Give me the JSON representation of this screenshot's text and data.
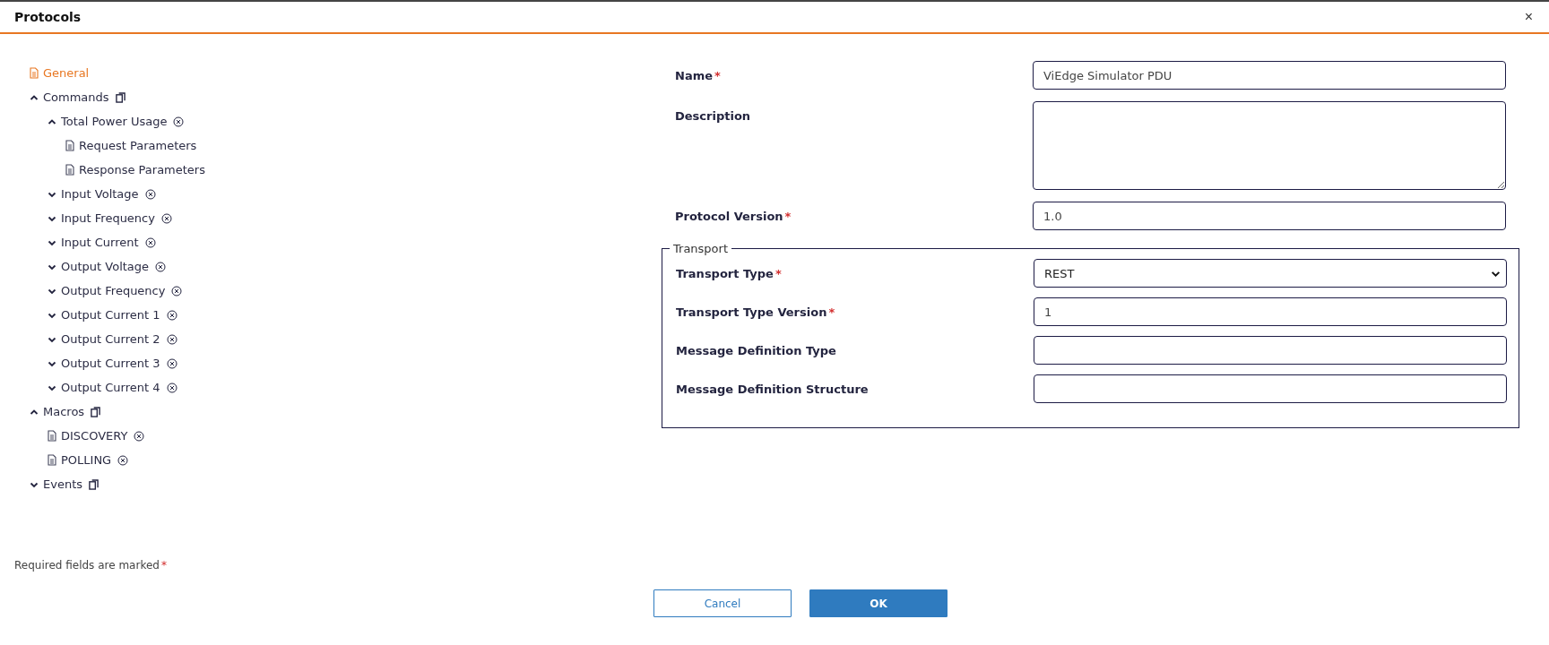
{
  "window": {
    "title": "Protocols",
    "close": "×"
  },
  "tree": [
    {
      "label": "General",
      "kind": "page",
      "selected": true
    },
    {
      "label": "Commands",
      "kind": "group",
      "expanded": true,
      "selected": false,
      "copyable": true,
      "children": [
        {
          "label": "Total Power Usage",
          "kind": "group",
          "expanded": true,
          "selected": false,
          "removable": true,
          "children": [
            {
              "label": "Request Parameters",
              "kind": "page",
              "selected": false
            },
            {
              "label": "Response Parameters",
              "kind": "page",
              "selected": false
            }
          ]
        },
        {
          "label": "Input Voltage",
          "kind": "group",
          "expanded": false,
          "selected": false,
          "removable": true
        },
        {
          "label": "Input Frequency",
          "kind": "group",
          "expanded": false,
          "selected": false,
          "removable": true
        },
        {
          "label": "Input Current",
          "kind": "group",
          "expanded": false,
          "selected": false,
          "removable": true
        },
        {
          "label": "Output Voltage",
          "kind": "group",
          "expanded": false,
          "selected": false,
          "removable": true
        },
        {
          "label": "Output Frequency",
          "kind": "group",
          "expanded": false,
          "selected": false,
          "removable": true
        },
        {
          "label": "Output Current 1",
          "kind": "group",
          "expanded": false,
          "selected": false,
          "removable": true
        },
        {
          "label": "Output Current 2",
          "kind": "group",
          "expanded": false,
          "selected": false,
          "removable": true
        },
        {
          "label": "Output Current 3",
          "kind": "group",
          "expanded": false,
          "selected": false,
          "removable": true
        },
        {
          "label": "Output Current 4",
          "kind": "group",
          "expanded": false,
          "selected": false,
          "removable": true
        }
      ]
    },
    {
      "label": "Macros",
      "kind": "group",
      "expanded": true,
      "selected": false,
      "copyable": true,
      "children": [
        {
          "label": "DISCOVERY",
          "kind": "page",
          "selected": false,
          "removable": true
        },
        {
          "label": "POLLING",
          "kind": "page",
          "selected": false,
          "removable": true
        }
      ]
    },
    {
      "label": "Events",
      "kind": "group",
      "expanded": false,
      "selected": false,
      "copyable": true
    }
  ],
  "form": {
    "fields": [
      {
        "label": "Name",
        "required": true,
        "kind": "text",
        "value": "ViEdge Simulator PDU"
      },
      {
        "label": "Description",
        "required": false,
        "kind": "textarea"
      },
      {
        "label": "Protocol Version",
        "required": true,
        "kind": "text",
        "value": "1.0"
      }
    ],
    "transport": {
      "legend": "Transport",
      "fields": [
        {
          "label": "Transport Type",
          "required": true,
          "kind": "select",
          "value": "REST"
        },
        {
          "label": "Transport Type Version",
          "required": true,
          "kind": "text",
          "value": "1"
        },
        {
          "label": "Message Definition Type",
          "required": false,
          "kind": "text"
        },
        {
          "label": "Message Definition Structure",
          "required": false,
          "kind": "text"
        }
      ]
    }
  },
  "footer": {
    "note": "Required fields are marked",
    "required_mark": "*",
    "buttons": [
      {
        "label": "Cancel",
        "kind": "secondary"
      },
      {
        "label": "OK",
        "kind": "primary"
      }
    ]
  }
}
